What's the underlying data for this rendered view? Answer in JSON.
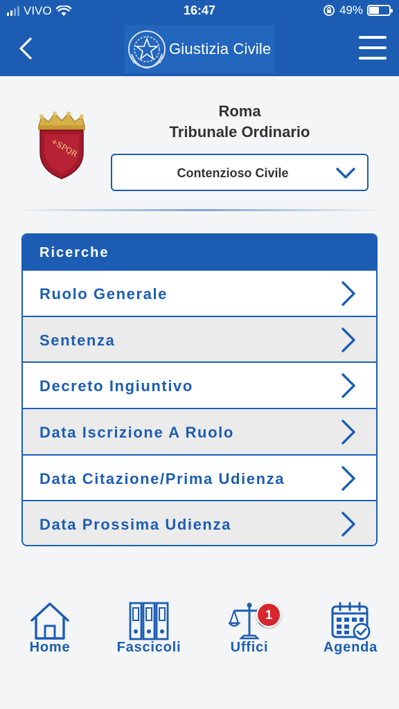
{
  "status_bar": {
    "carrier": "VIVO",
    "time": "16:47",
    "battery": "49%",
    "battery_level": 0.49,
    "icons": [
      "signal-icon",
      "wifi-icon",
      "orientation-lock-icon",
      "battery-icon"
    ]
  },
  "header": {
    "app_title": "Giustizia Civile",
    "back_icon": "chevron-left-icon",
    "menu_icon": "hamburger-menu-icon",
    "emblem_icon": "italian-republic-emblem-icon"
  },
  "court": {
    "city": "Roma",
    "name": "Tribunale Ordinario",
    "crest_icon": "rome-spqr-crest-icon",
    "selected_area": "Contenzioso Civile"
  },
  "search": {
    "title": "Ricerche",
    "items": [
      {
        "label": "Ruolo Generale"
      },
      {
        "label": "Sentenza"
      },
      {
        "label": "Decreto Ingiuntivo"
      },
      {
        "label": "Data Iscrizione A Ruolo"
      },
      {
        "label": "Data Citazione/Prima Udienza"
      },
      {
        "label": "Data Prossima Udienza"
      }
    ]
  },
  "tabbar": {
    "home": {
      "label": "Home",
      "icon": "home-icon"
    },
    "fascicoli": {
      "label": "Fascicoli",
      "icon": "binders-icon"
    },
    "uffici": {
      "label": "Uffici",
      "icon": "scales-icon",
      "badge": "1"
    },
    "agenda": {
      "label": "Agenda",
      "icon": "calendar-check-icon"
    }
  },
  "colors": {
    "primary": "#1c5db3",
    "row_alt": "#ebebeb",
    "badge": "#d8262e",
    "crest_red": "#a5192c",
    "crest_gold": "#d8b04a"
  }
}
